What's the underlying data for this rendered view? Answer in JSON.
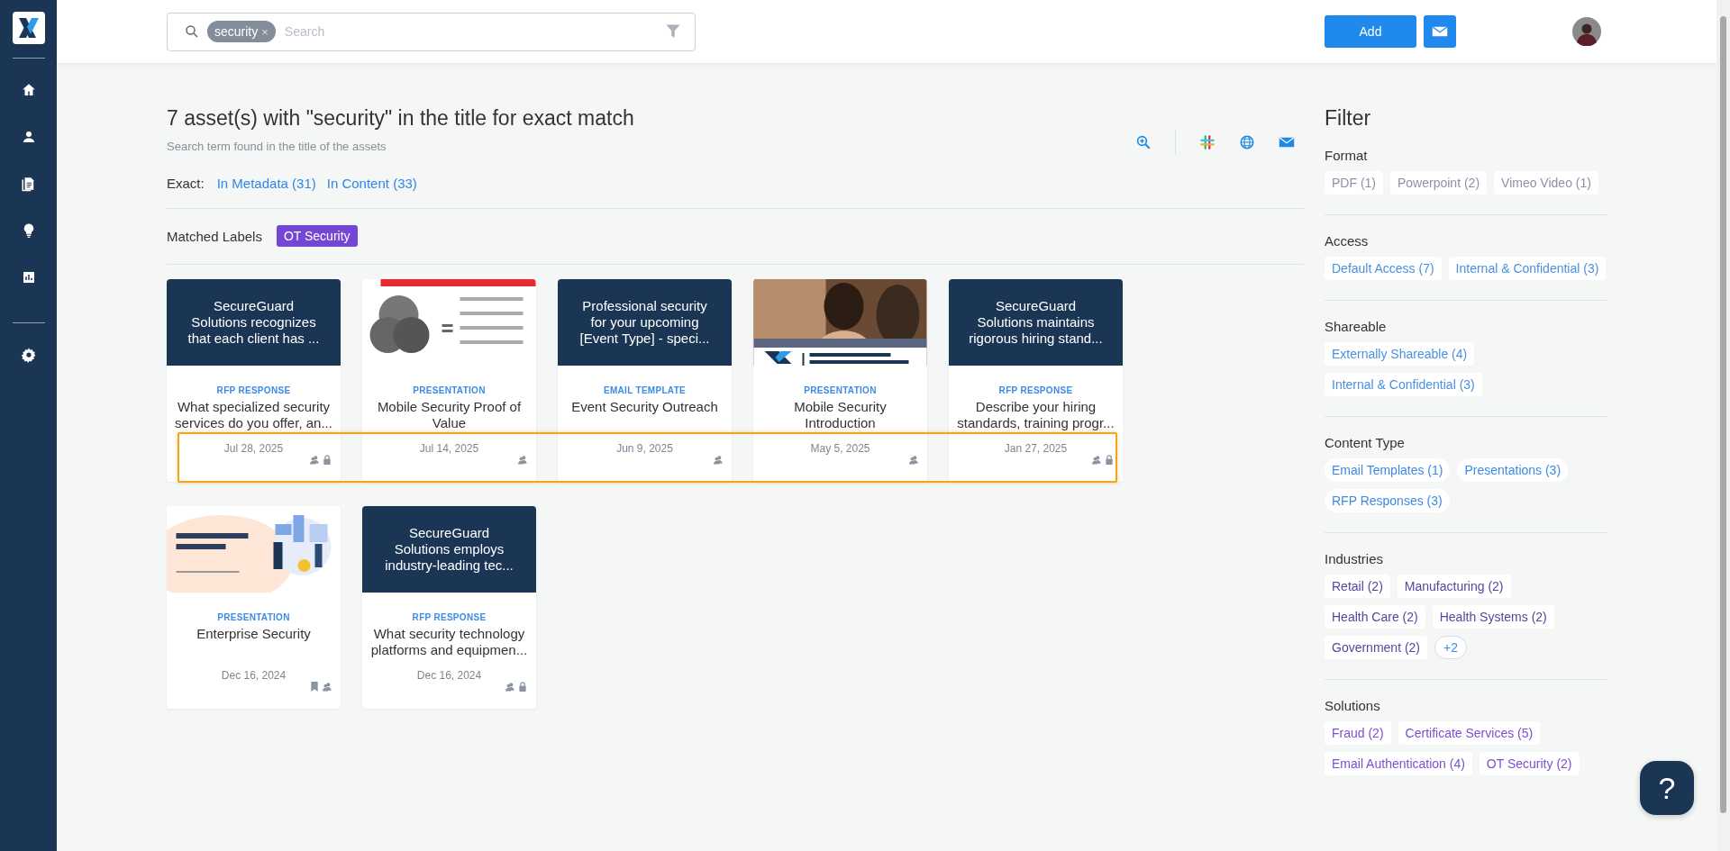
{
  "sidebar": {
    "items": [
      {
        "kind": "home"
      },
      {
        "kind": "person"
      },
      {
        "kind": "document"
      },
      {
        "kind": "bulb"
      },
      {
        "kind": "chart"
      },
      {
        "kind": "divider"
      },
      {
        "kind": "gear"
      }
    ]
  },
  "search": {
    "tag": "security",
    "tag_remove": "×",
    "placeholder": "Search"
  },
  "header_actions": {
    "add": "Add"
  },
  "results": {
    "title": "7 asset(s) with \"security\" in the title for exact match",
    "subtitle": "Search term found in the title of the assets",
    "exact_label": "Exact:",
    "exact_links": [
      "In Metadata (31)",
      "In Content (33)"
    ],
    "labels_title": "Matched Labels",
    "labels": [
      "OT Security"
    ],
    "annotation": {
      "kind": "highlight"
    },
    "cards": [
      {
        "thumbnail": {
          "kind": "text",
          "text": "SecureGuard Solutions recognizes that each client has ..."
        },
        "type": "RFP RESPONSE",
        "title": "What specialized security services do you offer, an...",
        "date": "Jul 28, 2025",
        "bookmarked": false,
        "shared": true,
        "locked": true
      },
      {
        "type": "PRESENTATION",
        "title": "Mobile Security Proof of Value",
        "date": "Jul 14, 2025",
        "bookmarked": false,
        "shared": true,
        "locked": false
      },
      {
        "thumbnail": {
          "kind": "text",
          "text": "Professional security for your upcoming [Event Type] - speci..."
        },
        "type": "EMAIL TEMPLATE",
        "title": "Event Security Outreach",
        "date": "Jun 9, 2025",
        "bookmarked": false,
        "shared": true,
        "locked": false
      },
      {
        "type": "PRESENTATION",
        "title": "Mobile Security Introduction",
        "date": "May 5, 2025",
        "bookmarked": false,
        "shared": true,
        "locked": false
      },
      {
        "thumbnail": {
          "kind": "text",
          "text": "SecureGuard Solutions maintains rigorous hiring stand..."
        },
        "type": "RFP RESPONSE",
        "title": "Describe your hiring standards, training progr...",
        "date": "Jan 27, 2025",
        "bookmarked": false,
        "shared": true,
        "locked": true
      },
      {
        "type": "PRESENTATION",
        "title": "Enterprise Security",
        "date": "Dec 16, 2024",
        "bookmarked": true,
        "shared": true,
        "locked": false
      },
      {
        "thumbnail": {
          "kind": "text",
          "text": "SecureGuard Solutions employs industry-leading tec..."
        },
        "type": "RFP RESPONSE",
        "title": "What security technology platforms and equipmen...",
        "date": "Dec 16, 2024",
        "bookmarked": false,
        "shared": true,
        "locked": true
      }
    ]
  },
  "filter": {
    "title": "Filter",
    "groups": [
      {
        "name": "Format",
        "kind": "tag",
        "color": "#8d92a3",
        "items": [
          "PDF (1)",
          "Powerpoint (2)",
          "Vimeo Video (1)"
        ]
      },
      {
        "name": "Access",
        "kind": "tag",
        "color": "#4a90e2",
        "items": [
          "Default Access (7)",
          "Internal & Confidential (3)"
        ]
      },
      {
        "name": "Shareable",
        "kind": "tag",
        "color": "#4a90e2",
        "items": [
          "Externally Shareable (4)",
          "Internal & Confidential (3)"
        ]
      },
      {
        "name": "Content Type",
        "kind": "pill",
        "color": "#3b8ae6",
        "items": [
          "Email Templates (1)",
          "Presentations (3)",
          "RFP Responses (3)"
        ]
      },
      {
        "name": "Industries",
        "kind": "tag",
        "color": "#4f4a9c",
        "items": [
          "Retail (2)",
          "Manufacturing (2)",
          "Health Care (2)",
          "Health Systems (2)",
          "Government (2)"
        ],
        "more": "+2"
      },
      {
        "name": "Solutions",
        "kind": "tag",
        "color": "#7a4fd3",
        "items": [
          "Fraud (2)",
          "Certificate Services (5)",
          "Email Authentication (4)",
          "OT Security (2)"
        ]
      }
    ]
  },
  "help": {
    "label": "?"
  }
}
